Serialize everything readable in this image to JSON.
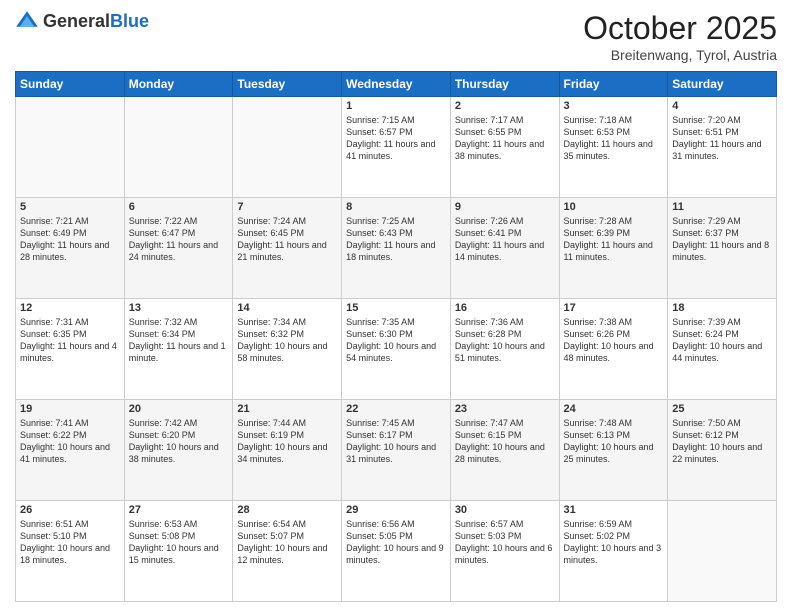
{
  "header": {
    "logo_general": "General",
    "logo_blue": "Blue",
    "month_title": "October 2025",
    "location": "Breitenwang, Tyrol, Austria"
  },
  "days_of_week": [
    "Sunday",
    "Monday",
    "Tuesday",
    "Wednesday",
    "Thursday",
    "Friday",
    "Saturday"
  ],
  "weeks": [
    [
      {
        "day": "",
        "info": ""
      },
      {
        "day": "",
        "info": ""
      },
      {
        "day": "",
        "info": ""
      },
      {
        "day": "1",
        "info": "Sunrise: 7:15 AM\nSunset: 6:57 PM\nDaylight: 11 hours and 41 minutes."
      },
      {
        "day": "2",
        "info": "Sunrise: 7:17 AM\nSunset: 6:55 PM\nDaylight: 11 hours and 38 minutes."
      },
      {
        "day": "3",
        "info": "Sunrise: 7:18 AM\nSunset: 6:53 PM\nDaylight: 11 hours and 35 minutes."
      },
      {
        "day": "4",
        "info": "Sunrise: 7:20 AM\nSunset: 6:51 PM\nDaylight: 11 hours and 31 minutes."
      }
    ],
    [
      {
        "day": "5",
        "info": "Sunrise: 7:21 AM\nSunset: 6:49 PM\nDaylight: 11 hours and 28 minutes."
      },
      {
        "day": "6",
        "info": "Sunrise: 7:22 AM\nSunset: 6:47 PM\nDaylight: 11 hours and 24 minutes."
      },
      {
        "day": "7",
        "info": "Sunrise: 7:24 AM\nSunset: 6:45 PM\nDaylight: 11 hours and 21 minutes."
      },
      {
        "day": "8",
        "info": "Sunrise: 7:25 AM\nSunset: 6:43 PM\nDaylight: 11 hours and 18 minutes."
      },
      {
        "day": "9",
        "info": "Sunrise: 7:26 AM\nSunset: 6:41 PM\nDaylight: 11 hours and 14 minutes."
      },
      {
        "day": "10",
        "info": "Sunrise: 7:28 AM\nSunset: 6:39 PM\nDaylight: 11 hours and 11 minutes."
      },
      {
        "day": "11",
        "info": "Sunrise: 7:29 AM\nSunset: 6:37 PM\nDaylight: 11 hours and 8 minutes."
      }
    ],
    [
      {
        "day": "12",
        "info": "Sunrise: 7:31 AM\nSunset: 6:35 PM\nDaylight: 11 hours and 4 minutes."
      },
      {
        "day": "13",
        "info": "Sunrise: 7:32 AM\nSunset: 6:34 PM\nDaylight: 11 hours and 1 minute."
      },
      {
        "day": "14",
        "info": "Sunrise: 7:34 AM\nSunset: 6:32 PM\nDaylight: 10 hours and 58 minutes."
      },
      {
        "day": "15",
        "info": "Sunrise: 7:35 AM\nSunset: 6:30 PM\nDaylight: 10 hours and 54 minutes."
      },
      {
        "day": "16",
        "info": "Sunrise: 7:36 AM\nSunset: 6:28 PM\nDaylight: 10 hours and 51 minutes."
      },
      {
        "day": "17",
        "info": "Sunrise: 7:38 AM\nSunset: 6:26 PM\nDaylight: 10 hours and 48 minutes."
      },
      {
        "day": "18",
        "info": "Sunrise: 7:39 AM\nSunset: 6:24 PM\nDaylight: 10 hours and 44 minutes."
      }
    ],
    [
      {
        "day": "19",
        "info": "Sunrise: 7:41 AM\nSunset: 6:22 PM\nDaylight: 10 hours and 41 minutes."
      },
      {
        "day": "20",
        "info": "Sunrise: 7:42 AM\nSunset: 6:20 PM\nDaylight: 10 hours and 38 minutes."
      },
      {
        "day": "21",
        "info": "Sunrise: 7:44 AM\nSunset: 6:19 PM\nDaylight: 10 hours and 34 minutes."
      },
      {
        "day": "22",
        "info": "Sunrise: 7:45 AM\nSunset: 6:17 PM\nDaylight: 10 hours and 31 minutes."
      },
      {
        "day": "23",
        "info": "Sunrise: 7:47 AM\nSunset: 6:15 PM\nDaylight: 10 hours and 28 minutes."
      },
      {
        "day": "24",
        "info": "Sunrise: 7:48 AM\nSunset: 6:13 PM\nDaylight: 10 hours and 25 minutes."
      },
      {
        "day": "25",
        "info": "Sunrise: 7:50 AM\nSunset: 6:12 PM\nDaylight: 10 hours and 22 minutes."
      }
    ],
    [
      {
        "day": "26",
        "info": "Sunrise: 6:51 AM\nSunset: 5:10 PM\nDaylight: 10 hours and 18 minutes."
      },
      {
        "day": "27",
        "info": "Sunrise: 6:53 AM\nSunset: 5:08 PM\nDaylight: 10 hours and 15 minutes."
      },
      {
        "day": "28",
        "info": "Sunrise: 6:54 AM\nSunset: 5:07 PM\nDaylight: 10 hours and 12 minutes."
      },
      {
        "day": "29",
        "info": "Sunrise: 6:56 AM\nSunset: 5:05 PM\nDaylight: 10 hours and 9 minutes."
      },
      {
        "day": "30",
        "info": "Sunrise: 6:57 AM\nSunset: 5:03 PM\nDaylight: 10 hours and 6 minutes."
      },
      {
        "day": "31",
        "info": "Sunrise: 6:59 AM\nSunset: 5:02 PM\nDaylight: 10 hours and 3 minutes."
      },
      {
        "day": "",
        "info": ""
      }
    ]
  ]
}
